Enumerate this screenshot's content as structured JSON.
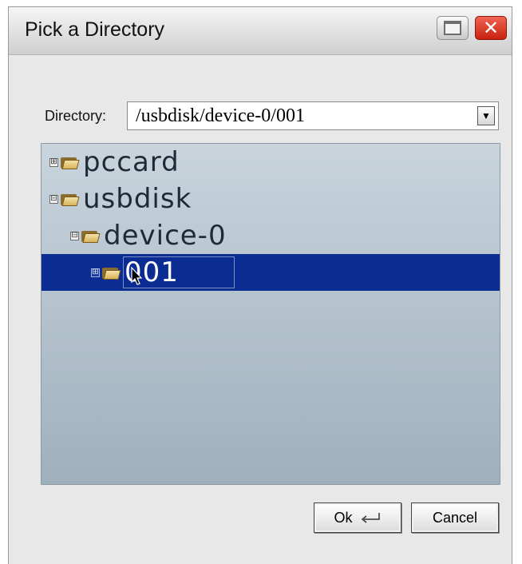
{
  "window": {
    "title": "Pick a Directory",
    "maximize_icon": "maximize-icon",
    "close_icon": "close-icon",
    "close_glyph": "✕"
  },
  "directory": {
    "label": "Directory:",
    "value": "/usbdisk/device-0/001",
    "dropdown_glyph": "▼"
  },
  "tree": {
    "nodes": [
      {
        "label": "pccard",
        "expander": "⊞",
        "selected": false
      },
      {
        "label": "usbdisk",
        "expander": "⊟",
        "selected": false
      },
      {
        "label": "device-0",
        "expander": "⊟",
        "selected": false
      },
      {
        "label": "001",
        "expander": "⊞",
        "selected": true
      }
    ]
  },
  "buttons": {
    "ok_label": "Ok",
    "cancel_label": "Cancel"
  },
  "colors": {
    "selection": "#0b2d93",
    "close_button": "#d8321f"
  }
}
